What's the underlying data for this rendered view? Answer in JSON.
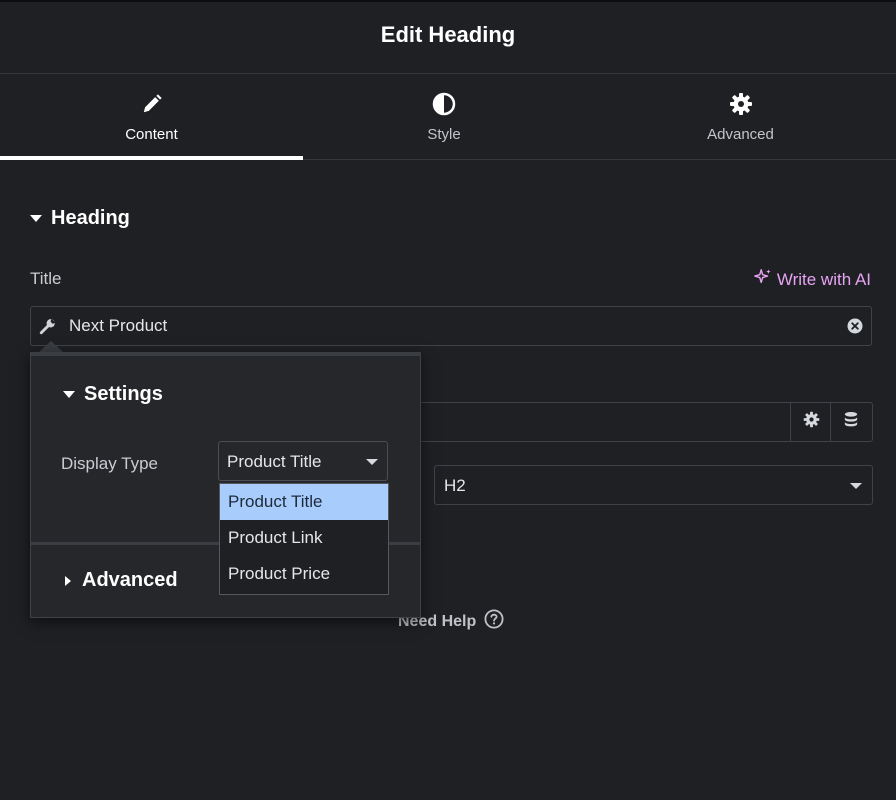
{
  "header": {
    "title": "Edit Heading"
  },
  "tabs": [
    {
      "label": "Content",
      "icon": "pencil-icon",
      "active": true
    },
    {
      "label": "Style",
      "icon": "half-circle-icon",
      "active": false
    },
    {
      "label": "Advanced",
      "icon": "gear-icon",
      "active": false
    }
  ],
  "section": {
    "title": "Heading"
  },
  "title_field": {
    "label": "Title",
    "ai_link": "Write with AI",
    "value": "Next Product"
  },
  "html_tag": {
    "value": "H2"
  },
  "help": {
    "label": "Need Help"
  },
  "popover": {
    "settings_title": "Settings",
    "display_type_label": "Display Type",
    "display_type_value": "Product Title",
    "advanced_title": "Advanced",
    "options": [
      "Product Title",
      "Product Link",
      "Product Price"
    ],
    "selected_option": "Product Title"
  },
  "colors": {
    "background": "#1f2024",
    "accent_ai": "#e7a3f2",
    "option_highlight": "#a8cdfc"
  }
}
